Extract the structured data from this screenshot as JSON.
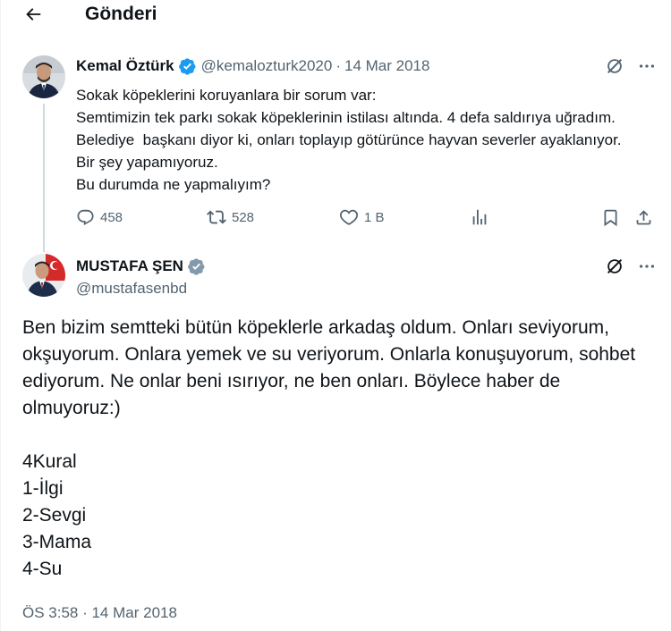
{
  "header": {
    "title": "Gönderi"
  },
  "quoted_tweet": {
    "author_name": "Kemal Öztürk",
    "handle": "@kemalozturk2020",
    "separator": "·",
    "date": "14 Mar 2018",
    "text": "Sokak köpeklerini koruyanlara bir sorum var:\nSemtimizin tek parkı sokak köpeklerinin istilası altında. 4 defa saldırıya uğradım. Belediye  başkanı diyor ki, onları toplayıp götürünce hayvan severler ayaklanıyor. Bir şey yapamıyoruz.\nBu durumda ne yapmalıyım?",
    "stats": {
      "replies": "458",
      "retweets": "528",
      "likes": "1 B"
    }
  },
  "main_tweet": {
    "author_name": "MUSTAFA ŞEN",
    "handle": "@mustafasenbd",
    "text": "Ben bizim semtteki bütün köpeklerle arkadaş oldum. Onları seviyorum, okşuyorum. Onlara yemek ve su veriyorum. Onlarla konuşuyorum, sohbet ediyorum. Ne onlar beni ısırıyor, ne ben onları. Böylece haber de olmuyoruz:)\n\n4Kural\n1-İlgi\n2-Sevgi\n3-Mama\n4-Su",
    "timestamp": "ÖS 3:58 · 14 Mar 2018"
  },
  "colors": {
    "text": "#0f1419",
    "secondary": "#536471",
    "verified": "#1d9bf0",
    "thread_line": "#cfd9de"
  },
  "icons": [
    "back-arrow-icon",
    "verified-badge-icon",
    "grok-icon",
    "more-icon",
    "reply-icon",
    "retweet-icon",
    "like-icon",
    "views-icon",
    "bookmark-icon",
    "share-icon"
  ]
}
